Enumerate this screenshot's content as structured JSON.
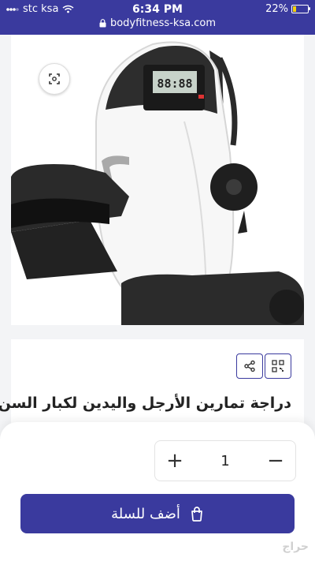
{
  "status_bar": {
    "carrier": "stc ksa",
    "time": "6:34 PM",
    "battery": "22%",
    "url": "bodyfitness-ksa.com"
  },
  "product": {
    "title": "دراجة تمارين الأرجل واليدين لكبار السن",
    "display_readout": "88:88"
  },
  "quantity": {
    "value": "1",
    "increment": "+",
    "decrement": "−"
  },
  "add_to_cart": {
    "label": "أضف للسلة"
  },
  "watermark": "حراج",
  "icons": {
    "share": "share-icon",
    "qr": "qr-code-icon",
    "zoom": "zoom-icon",
    "cart": "shopping-bag-icon",
    "lock": "lock-icon",
    "wifi": "wifi-icon"
  }
}
